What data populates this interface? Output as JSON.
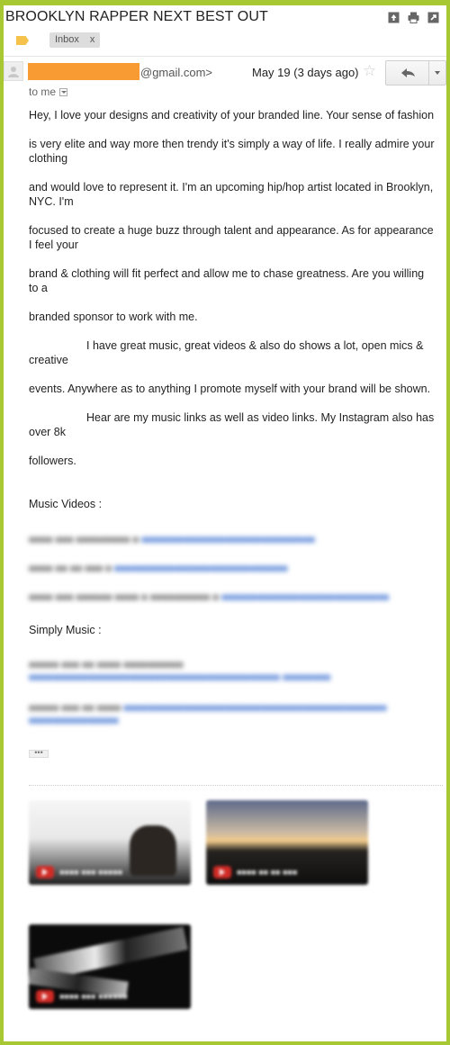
{
  "email": {
    "subject": "BROOKLYN RAPPER NEXT BEST OUT",
    "label_chip": "Inbox",
    "label_chip_close": "x",
    "sender_domain": "@gmail.com>",
    "date": "May 19 (3 days ago)",
    "star": "☆",
    "to_me": "to me",
    "body_paragraphs": [
      "Hey, I love your designs and creativity of your branded line. Your sense of fashion",
      "is very elite and way more then trendy it's simply a way of life. I really admire your clothing",
      "and would love to represent it. I'm an upcoming hip/hop artist located in Brooklyn, NYC. I'm",
      "focused to create a huge buzz through talent and appearance. As for appearance I feel your",
      "brand & clothing will fit perfect and allow me to chase greatness. Are you willing to a",
      "branded sponsor to work with me."
    ],
    "body_indented": [
      "I have great music, great videos & also do shows a lot, open mics & creative",
      "Hear are my music links as well as video links. My Instagram also has over 8k"
    ],
    "body_after_indented": [
      "events. Anywhere as to anything I promote myself with your brand will be shown.",
      "followers."
    ],
    "music_videos_heading": "Music Videos :",
    "simply_music_heading": "Simply Music :",
    "ellipsis": "•••"
  },
  "colors": {
    "frame_border": "#a7c832",
    "redaction": "#f89b32",
    "label_tag": "#f5c24c"
  },
  "icons": [
    "move-to-inbox-icon",
    "print-icon",
    "new-window-icon",
    "label-icon",
    "avatar-icon",
    "star-icon",
    "reply-icon",
    "chevron-down-icon",
    "play-icon"
  ]
}
